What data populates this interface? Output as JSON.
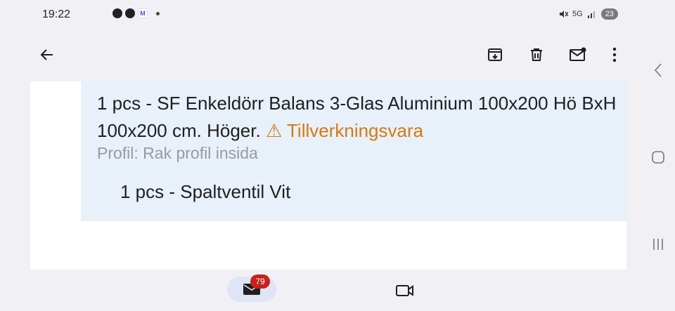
{
  "status_bar": {
    "time": "19:22",
    "network_label": "5G",
    "battery": "23"
  },
  "toolbar": {
    "back": "arrow-left-icon",
    "archive": "archive-icon",
    "delete": "trash-icon",
    "mark_unread": "mail-unread-icon",
    "more": "more-vertical-icon"
  },
  "email": {
    "item_line_1": "1 pcs - SF Enkeldörr Balans 3-Glas Aluminium 100x200 Hö BxH 100x200 cm. Höger.",
    "warning_text": "⚠ Tillverkningsvara",
    "profile_text": "Profil: Rak profil insida",
    "item_line_2": "1 pcs - Spaltventil Vit"
  },
  "bottom_nav": {
    "mail_badge": "79"
  },
  "colors": {
    "warning": "#d27a12",
    "badge": "#c5221f",
    "order_bg": "#e8f0fa"
  }
}
